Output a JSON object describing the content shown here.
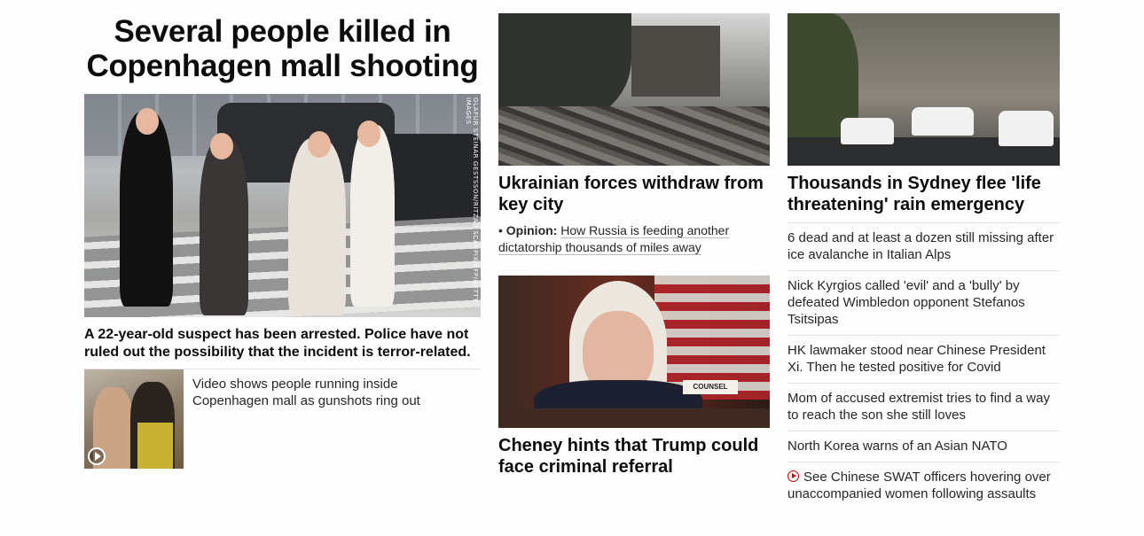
{
  "lead": {
    "headline": "Several people killed in Copenhagen mall shooting",
    "photo_credit": "OLAFUR STEINAR GESTSSON/RITZAU SCANPIX/AFP/GETTY IMAGES",
    "description": "A 22-year-old suspect has been arrested. Police have not ruled out the possibility that the incident is terror-related.",
    "video_link": "Video shows people running inside Copenhagen mall as gunshots ring out"
  },
  "middle": {
    "story1": {
      "headline": "Ukrainian forces withdraw from key city",
      "opinion_label": "Opinion:",
      "opinion_text": "How Russia is feeding another dictatorship thousands of miles away"
    },
    "story2": {
      "headline": "Cheney hints that Trump could face criminal referral",
      "sign_text": "COUNSEL"
    }
  },
  "right": {
    "headline": "Thousands in Sydney flee 'life threatening' rain emergency",
    "list": [
      "6 dead and at least a dozen still missing after ice avalanche in Italian Alps",
      "Nick Kyrgios called 'evil' and a 'bully' by defeated Wimbledon opponent Stefanos Tsitsipas",
      "HK lawmaker stood near Chinese President Xi. Then he tested positive for Covid",
      "Mom of accused extremist tries to find a way to reach the son she still loves",
      "North Korea warns of an Asian NATO",
      "See Chinese SWAT officers hovering over unaccompanied women following assaults"
    ]
  },
  "colors": {
    "text": "#262626",
    "video_icon": "#cc0000",
    "divider": "#e4e4e4"
  }
}
